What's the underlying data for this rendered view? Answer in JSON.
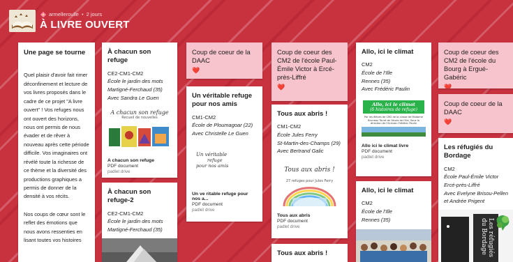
{
  "header": {
    "author": "armelleroulle",
    "time": "2 jours",
    "title": "À LIVRE OUVERT"
  },
  "col1": {
    "title": "Une page se tourne",
    "para1": "Quel plaisir d'avoir fait rimer déconfinement et lecture de vos livres proposés dans le cadre de ce projet \"A livre ouvert\" ! Vos refuges nous ont ouvert des horizons, nous ont permis de nous évader et de rêver à nouveau après cette période difficile. Vos imaginaires ont révélé toute la richesse de ce thème et la diversité des productions graphiques a permis de donner de la densité à vos récits.",
    "para2": "Nos coups de cœur sont le reflet des émotions que nous avons ressenties en lisant toutes vos histoires"
  },
  "col2": {
    "card1": {
      "title": "À chacun son refuge",
      "class": "CE2-CM1-CM2",
      "school": "École le jardin des mots",
      "place": "Martigné-Ferchaud (35)",
      "teacher": "Avec Sandra Le Guen",
      "thumb_title": "A chacun son refuge",
      "thumb_subtitle": "Recueil de nouvelles",
      "att_title": "A chacun son refuge",
      "att_type": "PDF document",
      "att_src": "padlet drive"
    },
    "card2": {
      "title": "À chacun son refuge-2",
      "class": "CE2-CM1-CM2",
      "school": "École le jardin des mots",
      "place": "Martigné-Ferchaud (35)"
    }
  },
  "col3": {
    "card1": {
      "title": "Coup de coeur de la DAAC",
      "heart": "❤️"
    },
    "card2": {
      "title": "Un véritable refuge pour nos amis",
      "class": "CM1-CM2",
      "school": "École de Ploumagoar (22)",
      "teacher": "Avec Christelle Le Guen",
      "thumb_line1": "Un véritable",
      "thumb_line2": "refuge",
      "thumb_line3": "pour nos amis",
      "att_title": "Un ve ritable refuge pour nos a...",
      "att_type": "PDF document",
      "att_src": "padlet drive"
    }
  },
  "col4": {
    "card1": {
      "title": "Coup de coeur des CM2 de l'école Paul-Émile Victor à Ercé-près-Liffré",
      "heart": "❤️"
    },
    "card2": {
      "title": "Tous aux abris !",
      "class": "CM1-CM2",
      "school": "École Jules Ferry",
      "place": "St-Martin-des-Champs (29)",
      "teacher": "Avec Bertrand Galic",
      "thumb_title": "Tous aux abris !",
      "thumb_subtitle": "27 refuges pour Jules Ferry",
      "att_title": "Tous aux abris",
      "att_type": "PDF document",
      "att_src": "padlet drive"
    },
    "card3": {
      "title": "Tous aux abris !"
    }
  },
  "col5": {
    "card1": {
      "title": "Allo, ici le climat",
      "class": "CM2",
      "school": "École de l'Ille",
      "place": "Rennes (35)",
      "teacher": "Avec Frédéric Paulin",
      "thumb_title": "Allo, ici le climat",
      "thumb_subtitle": "(6 histoires de refuge)",
      "thumb_caption": "Par les élèves de CM2 de la classe de Madame Bruneau Touré de l'école de l'Ille, Sous la direction de l'écrivain Frédéric Paulin",
      "att_title": "Allo ici le climat livre",
      "att_type": "PDF document",
      "att_src": "padlet drive"
    },
    "card2": {
      "title": "Allo, ici le climat",
      "class": "CM2",
      "school": "École de l'Ille",
      "place": "Rennes (35)"
    }
  },
  "col6": {
    "card1": {
      "title": "Coup de coeur des CM2 de l'école du Bourg à Ergué-Gabéric",
      "heart": "❤️"
    },
    "card2": {
      "title": "Coup de coeur de la DAAC",
      "heart": "❤️"
    },
    "card3": {
      "title": "Les réfugiés du Bordage",
      "class": "CM2",
      "school": "École Paul-Émile Victor",
      "place": "Ercé-près-Liffré",
      "teacher": "Avec Evelyne Brisou-Pellen et Andrée Prigent",
      "book_spine": "Les réfugiés du Bordage"
    }
  },
  "colors": {
    "background": "#c8323f",
    "pink_card": "#f7c3cc",
    "heart": "#d8273a"
  }
}
